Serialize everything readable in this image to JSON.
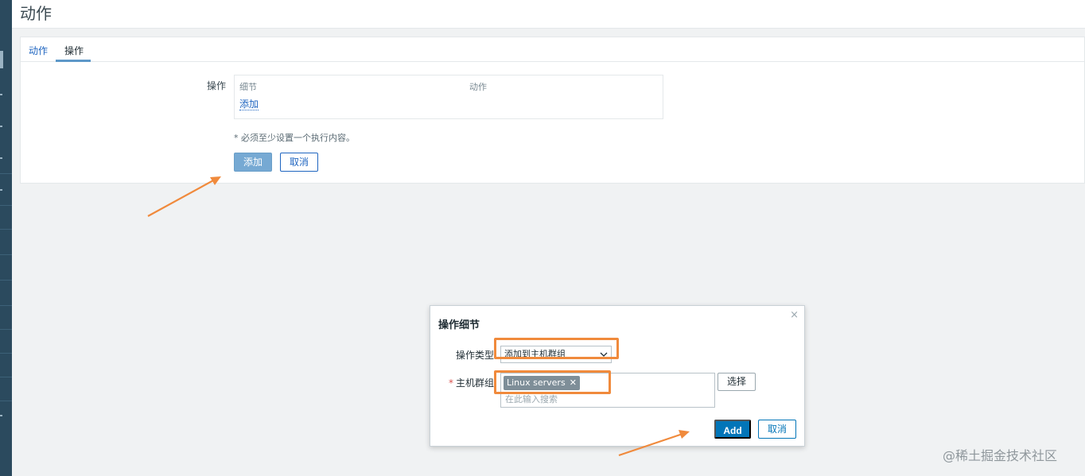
{
  "header": {
    "title": "动作"
  },
  "tabs": [
    {
      "label": "动作",
      "active": false
    },
    {
      "label": "操作",
      "active": true
    }
  ],
  "operations_form": {
    "label": "操作",
    "table_headers": {
      "detail": "细节",
      "action": "动作"
    },
    "add_link": "添加",
    "hint": "* 必须至少设置一个执行内容。",
    "add_button": "添加",
    "cancel_button": "取消"
  },
  "modal": {
    "title": "操作细节",
    "close_glyph": "×",
    "operation_type_label": "操作类型",
    "operation_type_value": "添加到主机群组",
    "host_group_required": "*",
    "host_group_label": "主机群组",
    "host_group_chip": "Linux servers",
    "chip_remove_glyph": "✕",
    "host_group_placeholder": "在此输入搜索",
    "select_button": "选择",
    "add_button": "Add",
    "cancel_button": "取消"
  },
  "watermark": "@稀土掘金技术社区",
  "colors": {
    "link": "#1f65c0",
    "primary": "#0275b8",
    "highlight": "#f08a3c",
    "sidebar": "#2b4a5e"
  },
  "icons": {
    "chevron": "chevron-down-icon",
    "close": "close-icon",
    "chip_remove": "remove-icon"
  }
}
